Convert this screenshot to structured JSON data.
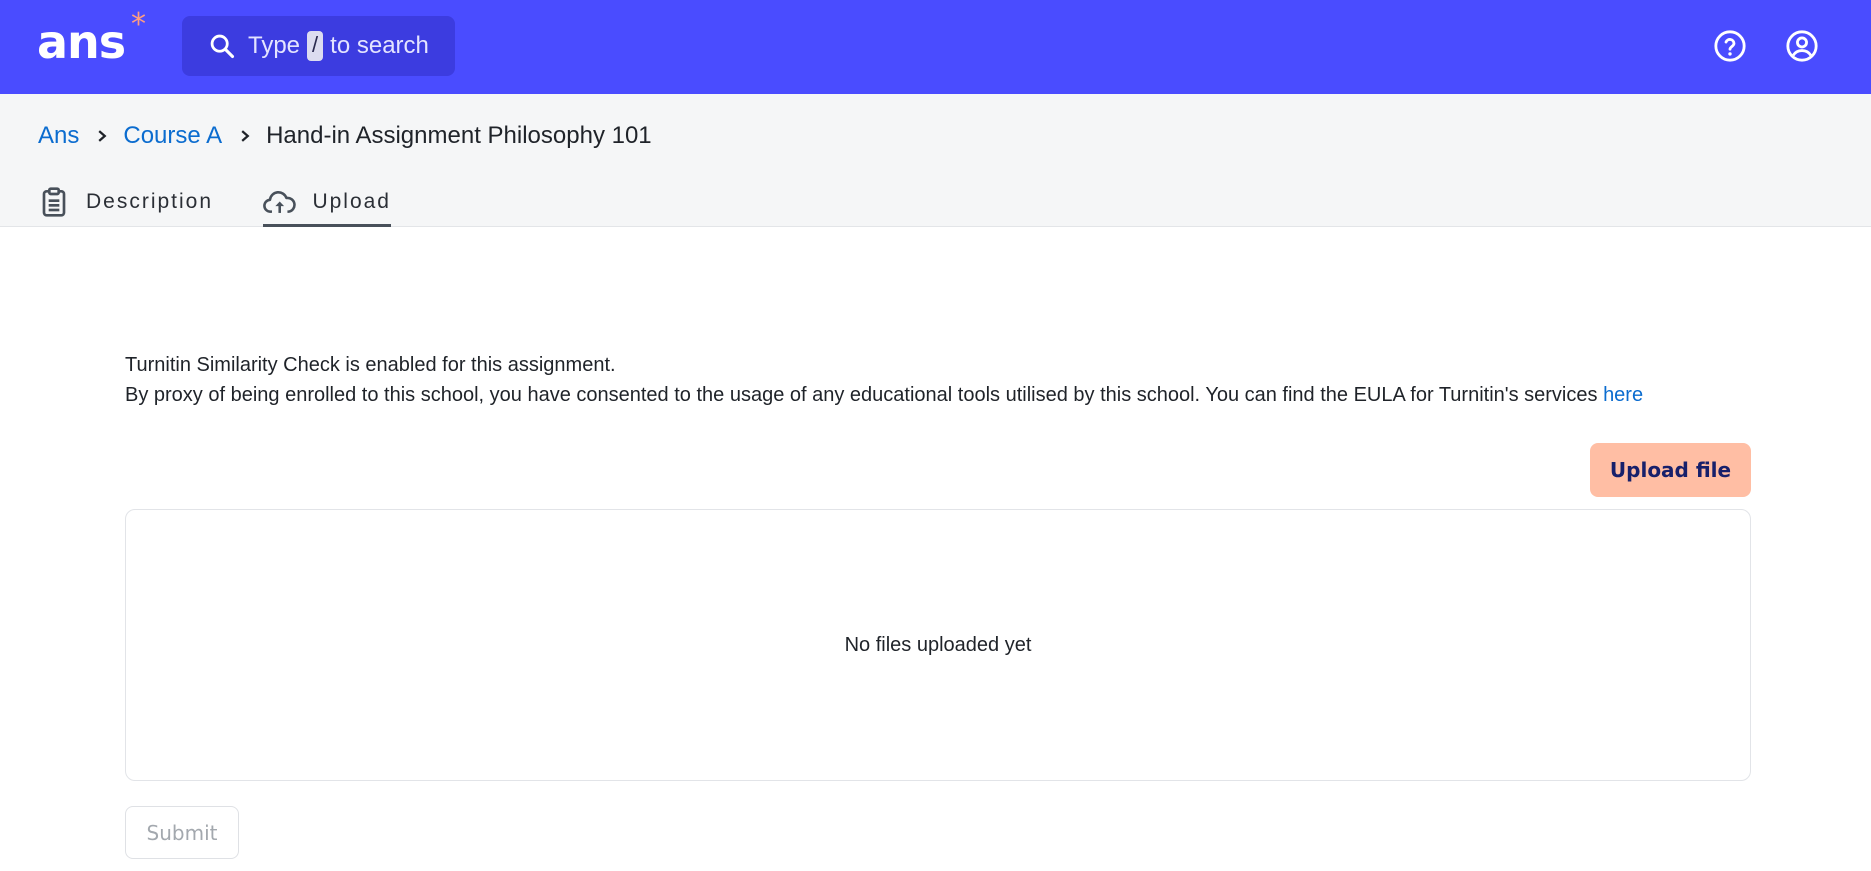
{
  "app": {
    "logo_text": "ans",
    "logo_mark": "*"
  },
  "header": {
    "search": {
      "prefix": "Type",
      "shortcut": "/",
      "suffix": "to search"
    },
    "icons": [
      "help-circle-icon",
      "user-circle-icon"
    ]
  },
  "breadcrumb": {
    "items": [
      "Ans",
      "Course A"
    ],
    "current": "Hand-in Assignment Philosophy 101"
  },
  "tabs": [
    {
      "label": "Description",
      "icon": "clipboard-icon",
      "active": false
    },
    {
      "label": "Upload",
      "icon": "cloud-upload-icon",
      "active": true
    }
  ],
  "notice": {
    "line1": "Turnitin Similarity Check is enabled for this assignment.",
    "line2": "By proxy of being enrolled to this school, you have consented to the usage of any educational tools utilised by this school. You can find the EULA for Turnitin's services",
    "link_text": "here"
  },
  "upload": {
    "button_label": "Upload file",
    "empty_text": "No files uploaded yet",
    "submit_label": "Submit"
  },
  "colors": {
    "topbar": "#4a4cff",
    "search_bg": "#3c3ce0",
    "link": "#0b6ccf",
    "upload_button": "#ffbea4",
    "upload_button_text": "#17206b",
    "logo_mark": "#ff9e80"
  }
}
